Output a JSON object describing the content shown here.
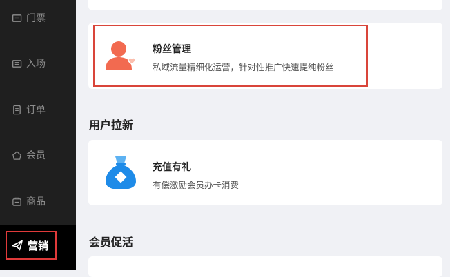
{
  "sidebar": {
    "items": [
      {
        "label": "门票",
        "icon": "ticket-icon"
      },
      {
        "label": "入场",
        "icon": "entry-icon"
      },
      {
        "label": "订单",
        "icon": "order-icon"
      },
      {
        "label": "会员",
        "icon": "member-icon"
      },
      {
        "label": "商品",
        "icon": "goods-icon"
      }
    ],
    "active": {
      "label": "营销",
      "icon": "paper-plane-icon"
    }
  },
  "main": {
    "fans_card": {
      "title": "粉丝管理",
      "description": "私域流量精细化运营，针对性推广快速提纯粉丝",
      "icon": "fans-user-heart-icon"
    },
    "section_new_users": {
      "title": "用户拉新"
    },
    "recharge_card": {
      "title": "充值有礼",
      "description": "有偿激励会员办卡消费",
      "icon": "money-bag-icon"
    },
    "section_member_activation": {
      "title": "会员促活"
    }
  },
  "colors": {
    "sidebar_bg": "#1f1f1f",
    "active_bg": "#000000",
    "highlight_border": "#d9453a",
    "fans_icon": "#f26a50",
    "recharge_icon": "#1e8be8"
  }
}
